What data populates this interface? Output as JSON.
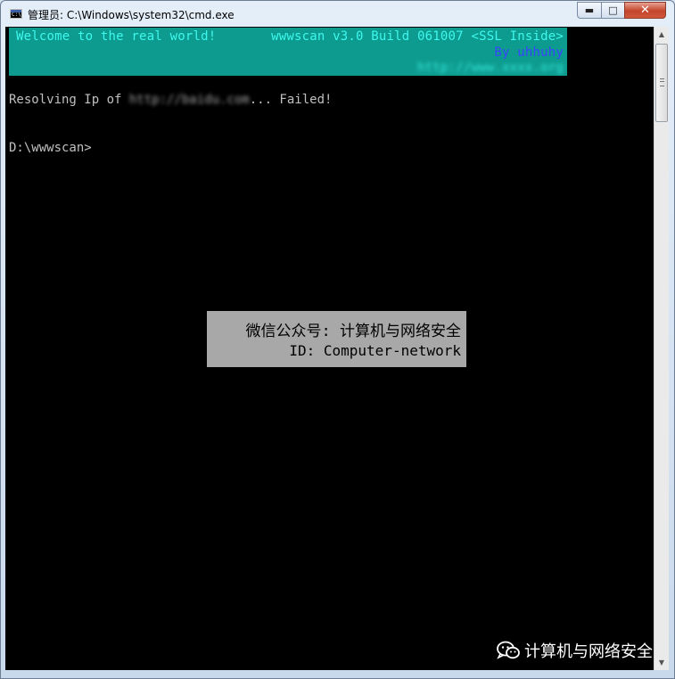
{
  "window": {
    "title": "管理员: C:\\Windows\\system32\\cmd.exe",
    "icon": "cmd-icon",
    "icon_text": "C:\\"
  },
  "controls": {
    "minimize": "minimize-icon",
    "maximize": "maximize-icon",
    "close": "close-icon"
  },
  "banner": {
    "welcome": "Welcome to the real world!",
    "version": "wwwscan v3.0 Build 061007 <SSL Inside>",
    "author": "By uhhuhy",
    "url_blurred": "http://www.xxxx.org",
    "background_color": "#0e9b8f",
    "text_color": "#3df8ee",
    "author_color": "#3a43ff"
  },
  "console": {
    "line1_prefix": "Resolving Ip of ",
    "line1_host_blurred": "http://baidu.com",
    "line1_suffix": "... Failed!",
    "prompt": "D:\\wwwscan>"
  },
  "watermark": {
    "line1": "微信公众号: 计算机与网络安全",
    "line2": "ID: Computer-network"
  },
  "brand": {
    "icon": "wechat-icon",
    "text": "计算机与网络安全"
  }
}
